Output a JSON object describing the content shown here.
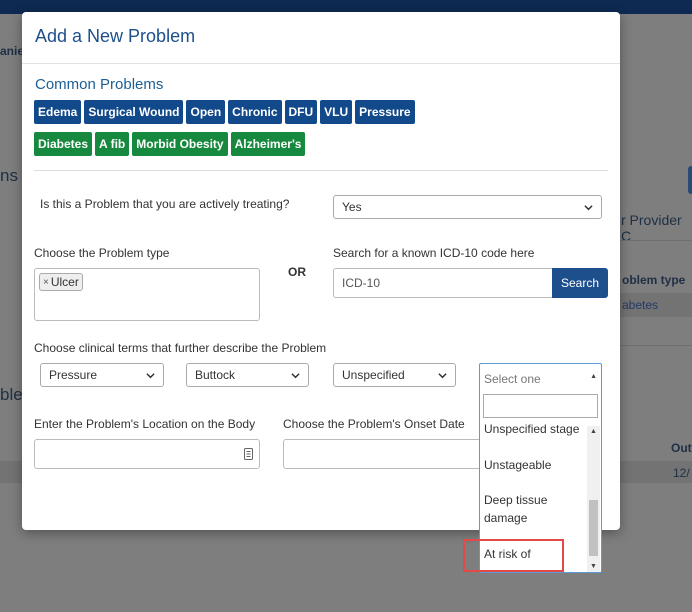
{
  "background": {
    "partial_name": "anie",
    "partial_heading_1": "ns",
    "partial_heading_2": "ble",
    "partial_provider": "r Provider C",
    "partial_col_header": "oblem type",
    "partial_link": "abetes",
    "partial_out": "Outc",
    "partial_date": "12/"
  },
  "modal": {
    "title": "Add a New Problem",
    "common_problems_title": "Common Problems",
    "chips_blue": [
      "Edema",
      "Surgical Wound",
      "Open",
      "Chronic",
      "DFU",
      "VLU",
      "Pressure"
    ],
    "chips_green": [
      "Diabetes",
      "A fib",
      "Morbid Obesity",
      "Alzheimer's"
    ],
    "treating_question": "Is this a Problem that you are actively treating?",
    "treating_value": "Yes",
    "problem_type_label": "Choose the Problem type",
    "problem_type_tag": "Ulcer",
    "or_label": "OR",
    "icd_label": "Search for a known ICD-10 code here",
    "icd_placeholder": "ICD-10",
    "search_button": "Search",
    "clinical_terms_label": "Choose clinical terms that further describe the Problem",
    "term_1": "Pressure",
    "term_2": "Buttock",
    "term_3": "Unspecified",
    "location_label": "Enter the Problem's Location on the Body",
    "onset_label": "Choose the Problem's Onset Date"
  },
  "dropdown": {
    "selected": "Select one",
    "options": [
      "Unspecified stage",
      "Unstageable",
      "Deep tissue damage",
      "At risk of"
    ]
  },
  "icons": [
    "chevron-down-icon",
    "remove-tag-icon",
    "keypad-icon",
    "scroll-up-icon",
    "scroll-down-icon"
  ],
  "colors": {
    "title_blue": "#1d4f8c",
    "chip_blue": "#12498a",
    "chip_green": "#17893e",
    "highlight_red": "#e24a4a"
  }
}
